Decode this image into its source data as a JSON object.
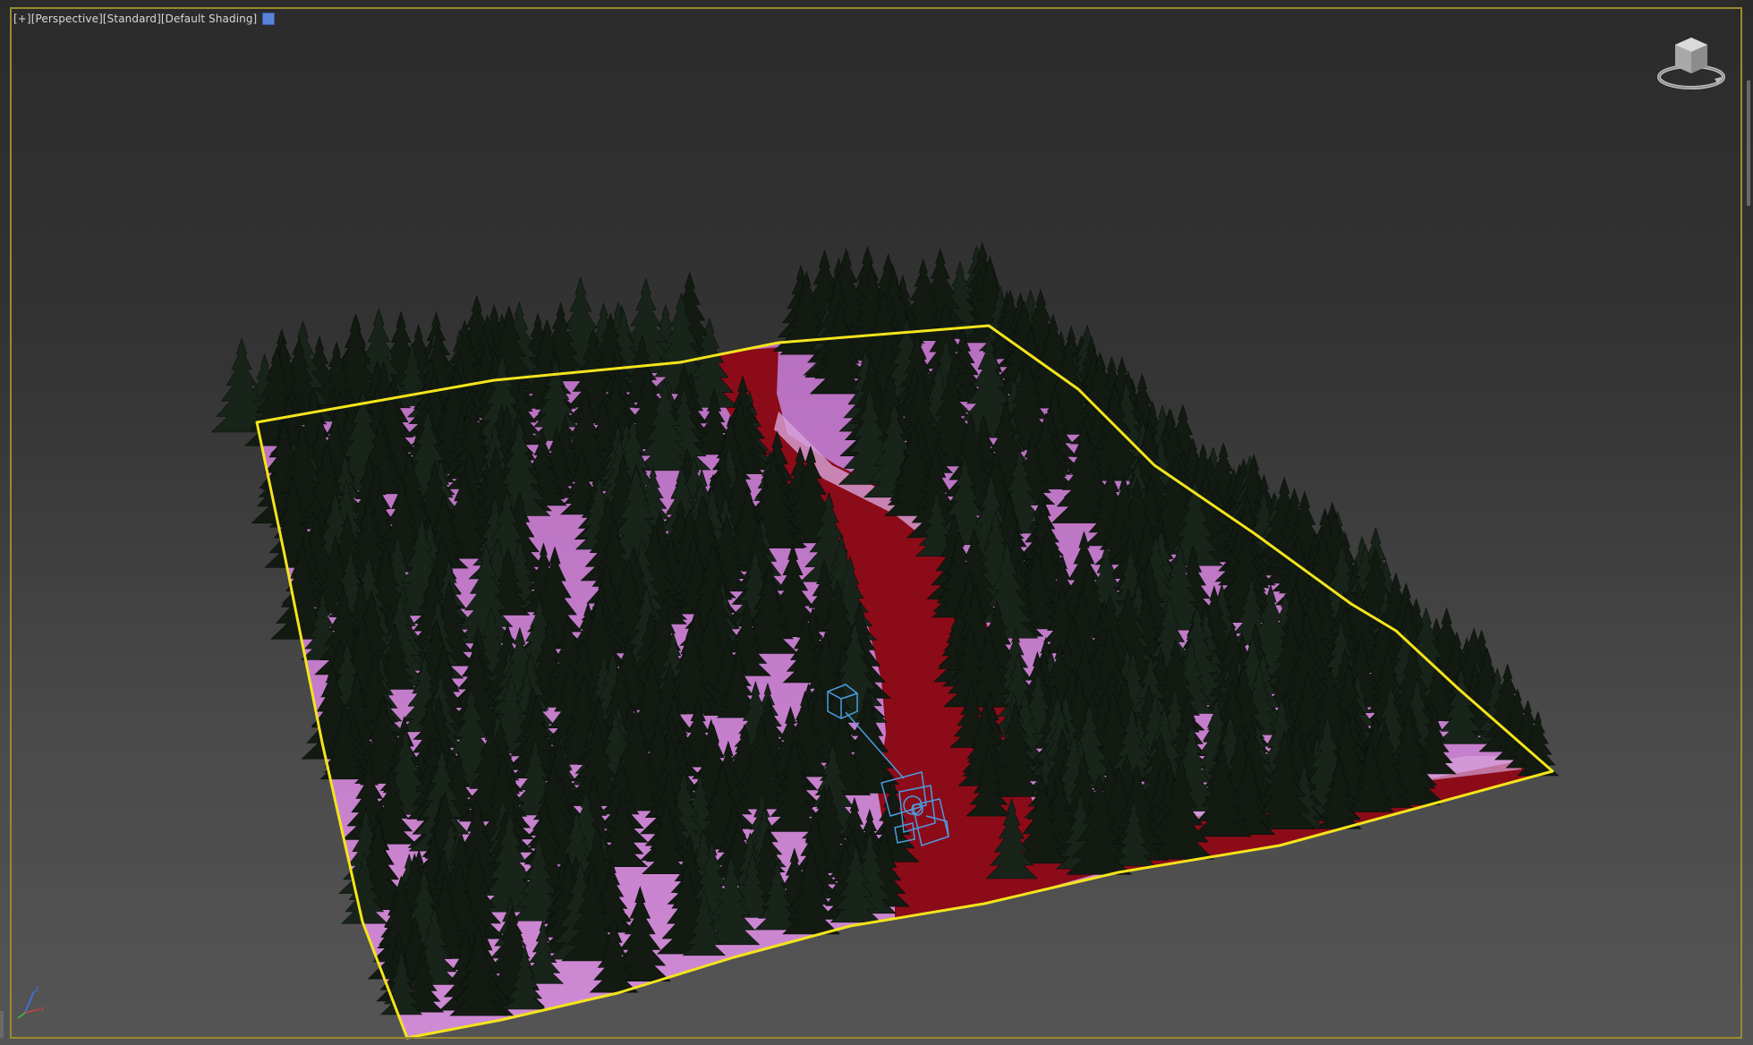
{
  "viewport": {
    "label_plus": "[+]",
    "label_view": "[Perspective]",
    "label_mode": "[Standard]",
    "label_shading": "[Default Shading]",
    "swatch_color": "#5a82d8",
    "border_color": "#9c8a2a"
  },
  "scene": {
    "terrain_outline_color": "#f4e41c",
    "road_color": "#8c0b18",
    "ground_color": "#c27cc8",
    "tree_color": "#121a12",
    "camera_color": "#4a9ee0"
  },
  "icons": {
    "viewcube": "viewcube-icon",
    "axis": "axis-tripod-icon"
  },
  "axis": {
    "z": "z",
    "x": "x"
  }
}
